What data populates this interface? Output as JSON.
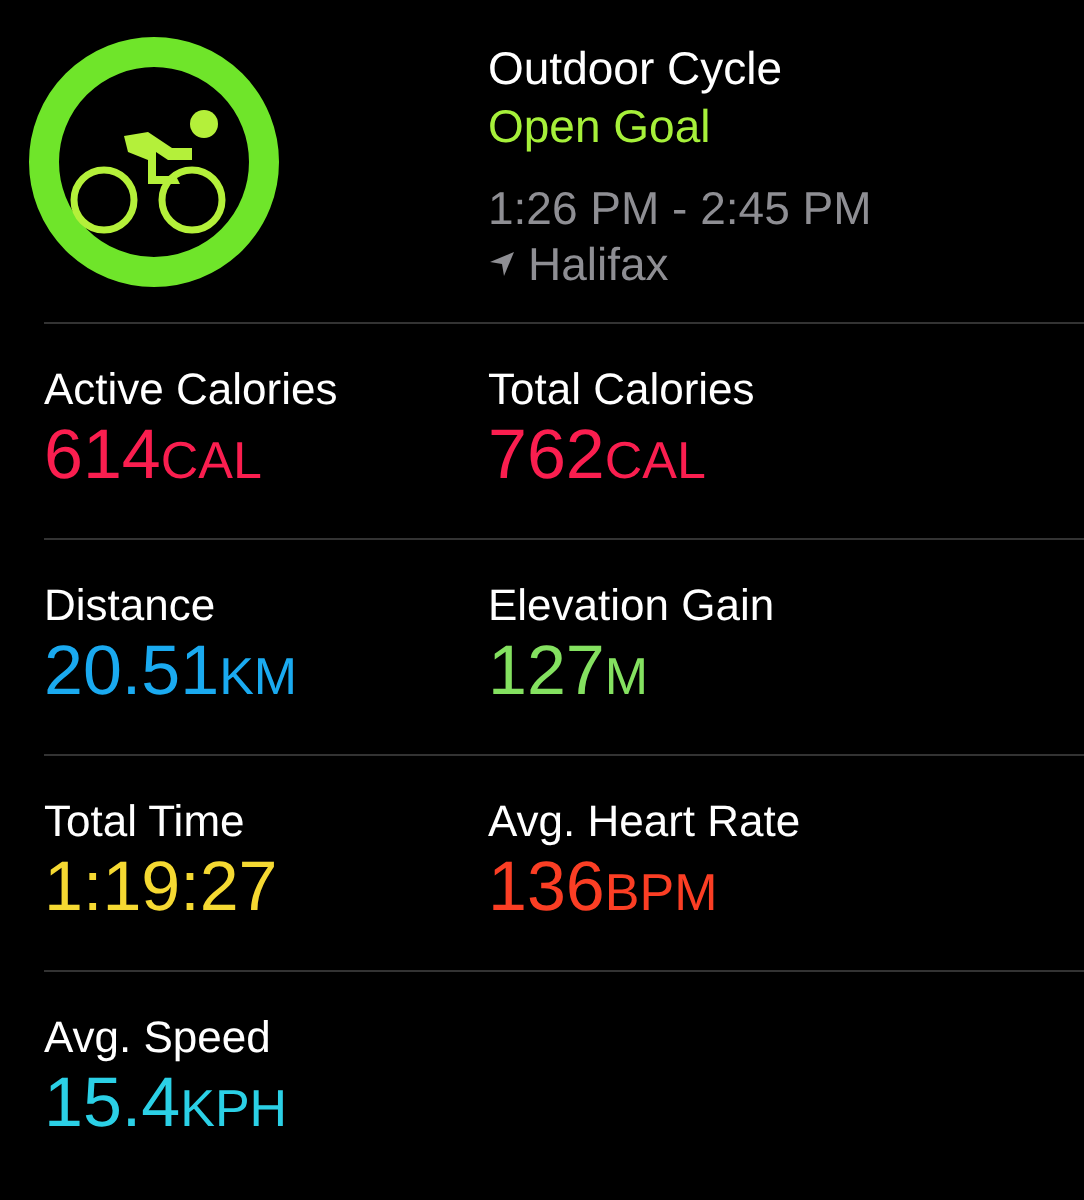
{
  "workout": {
    "title": "Outdoor Cycle",
    "goal": "Open Goal",
    "time_range": "1:26 PM - 2:45 PM",
    "location": "Halifax"
  },
  "metrics": [
    {
      "label": "Active Calories",
      "value": "614",
      "unit": "CAL",
      "color": "#fa1e4f"
    },
    {
      "label": "Total Calories",
      "value": "762",
      "unit": "CAL",
      "color": "#fa1e4f"
    },
    {
      "label": "Distance",
      "value": "20.51",
      "unit": "KM",
      "color": "#1aaaf0"
    },
    {
      "label": "Elevation Gain",
      "value": "127",
      "unit": "M",
      "color": "#84e160"
    },
    {
      "label": "Total Time",
      "value": "1:19:27",
      "color": "#f5d932"
    },
    {
      "label": "Avg. Heart Rate",
      "value": "136",
      "unit": "BPM",
      "color": "#fb3e24"
    },
    {
      "label": "Avg. Speed",
      "value": "15.4",
      "unit": "KPH",
      "color": "#2bd0e6"
    }
  ]
}
